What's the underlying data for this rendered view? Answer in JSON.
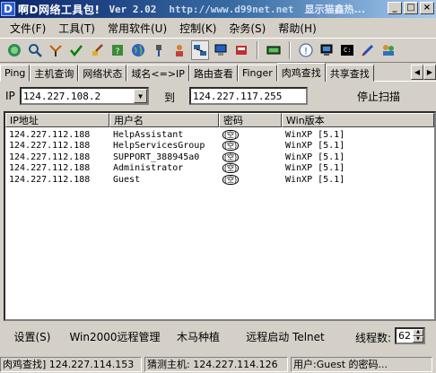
{
  "title": {
    "app_name": "啊D网络工具包!",
    "version": "Ver 2.02",
    "url": "http://www.d99net.net",
    "ticker": "显示猫鑫热..."
  },
  "window_buttons": {
    "minimize": "_",
    "maximize": "□",
    "close": "×"
  },
  "menu": [
    "文件(F)",
    "工具(T)",
    "常用软件(U)",
    "控制(K)",
    "杂务(S)",
    "帮助(H)"
  ],
  "toolbar_icons": [
    "globe-icon",
    "search-icon",
    "antenna-icon",
    "check-icon",
    "brush-icon",
    "help-book-icon",
    "earth-icon",
    "network-cable-icon",
    "user-icon",
    "network-scan-icon",
    "computer-icon",
    "terminal-icon",
    "settings-icon",
    "info-icon",
    "monitor-icon",
    "console-icon",
    "pen-icon",
    "group-icon"
  ],
  "tabs": [
    "Ping",
    "主机查询",
    "网络状态",
    "域名<=>IP",
    "路由查看",
    "Finger",
    "肉鸡查找",
    "共享查找"
  ],
  "active_tab": "肉鸡查找",
  "ip_range": {
    "label": "IP",
    "from": "124.227.108.2",
    "to_label": "到",
    "to": "124.227.117.255",
    "stop_button": "停止扫描"
  },
  "list": {
    "columns": [
      "IP地址",
      "用户名",
      "密码",
      "Win版本"
    ],
    "rows": [
      {
        "ip": "124.227.112.188",
        "user": "HelpAssistant",
        "password": "(空)",
        "win": "WinXP [5.1]"
      },
      {
        "ip": "124.227.112.188",
        "user": "HelpServicesGroup",
        "password": "(空)",
        "win": "WinXP [5.1]"
      },
      {
        "ip": "124.227.112.188",
        "user": "SUPPORT_388945a0",
        "password": "(空)",
        "win": "WinXP [5.1]"
      },
      {
        "ip": "124.227.112.188",
        "user": "Administrator",
        "password": "(空)",
        "win": "WinXP [5.1]"
      },
      {
        "ip": "124.227.112.188",
        "user": "Guest",
        "password": "(空)",
        "win": "WinXP [5.1]"
      }
    ]
  },
  "buttons": {
    "settings": "设置(S)",
    "win2000_remote": "Win2000远程管理",
    "trojan": "木马种植",
    "telnet": "远程启动 Telnet",
    "threads_label": "线程数:",
    "threads_value": "62"
  },
  "status": {
    "panel1": "肉鸡查找] 124.227.114.153",
    "panel2": "猜测主机: 124.227.114.126",
    "panel3": "用户:Guest 的密码..."
  }
}
